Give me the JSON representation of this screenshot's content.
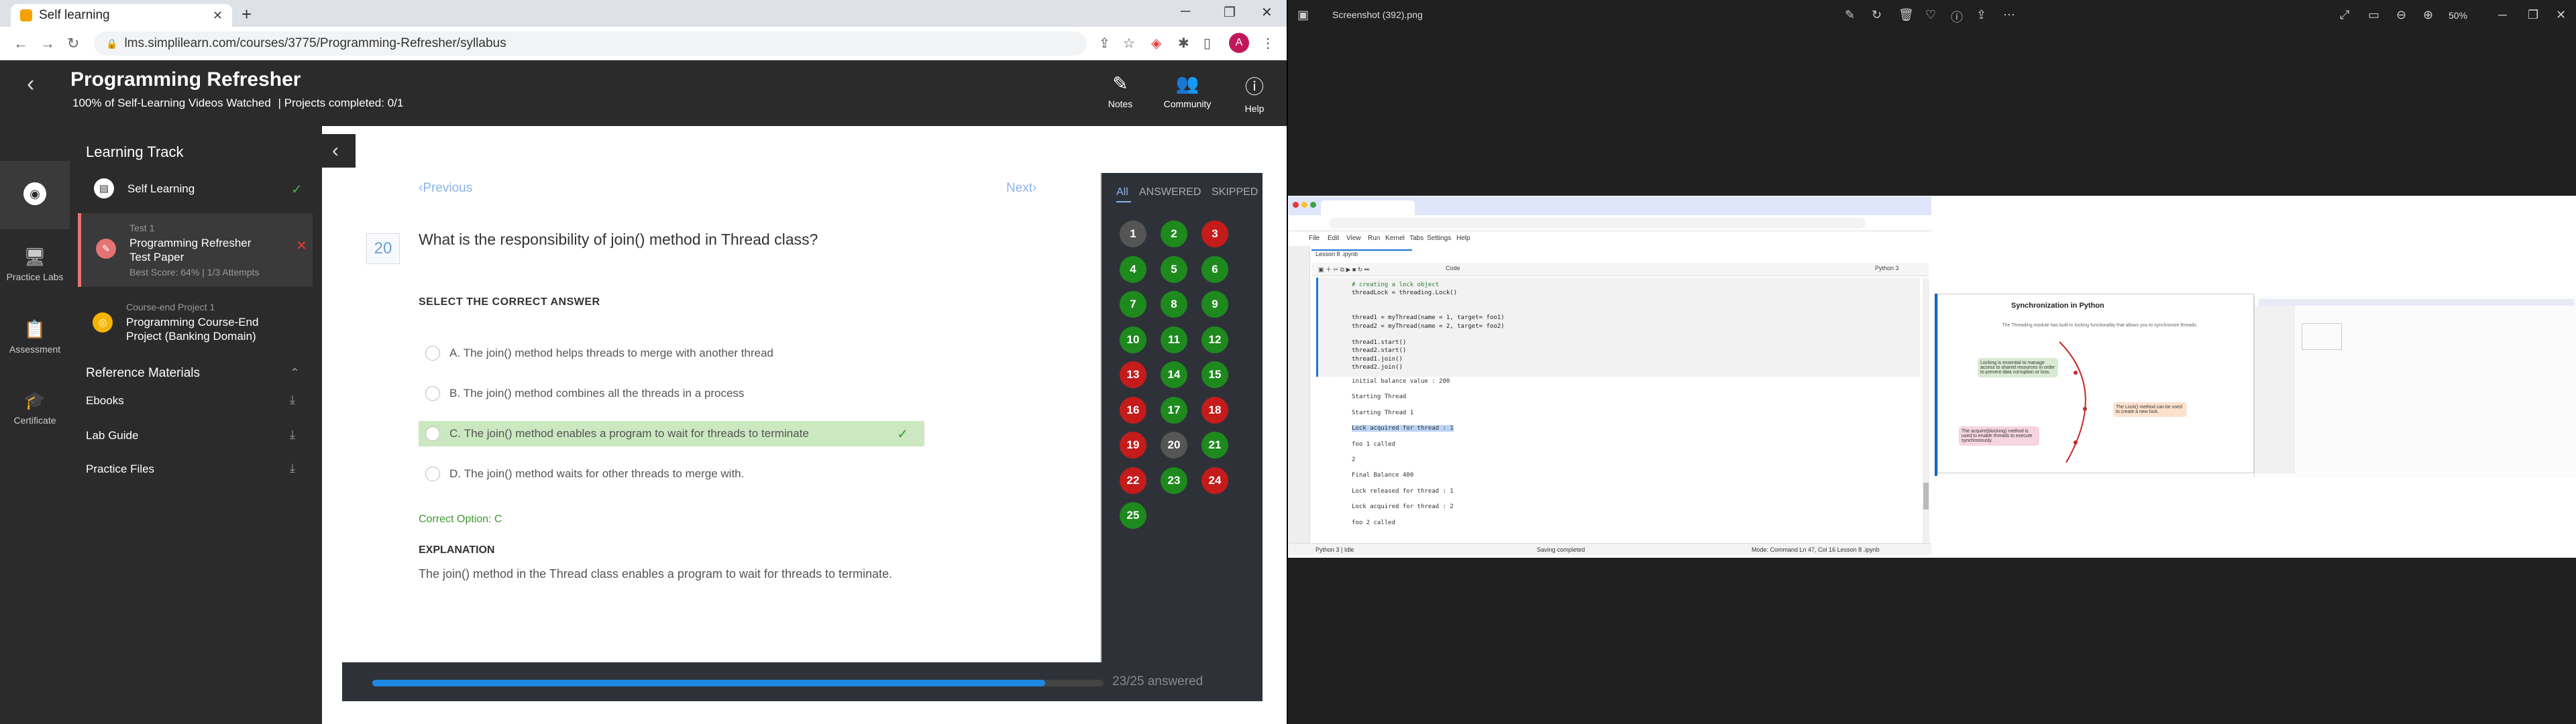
{
  "browser": {
    "tab_title": "Self learning",
    "url": "lms.simplilearn.com/courses/3775/Programming-Refresher/syllabus",
    "avatar_letter": "A"
  },
  "header": {
    "title": "Programming Refresher",
    "subtitle": "100% of Self-Learning Videos Watched",
    "projects": "| Projects completed: 0/1",
    "actions": [
      "Notes",
      "Community",
      "Help"
    ]
  },
  "rail": {
    "items": [
      "Practice Labs",
      "Assessment",
      "Certificate"
    ]
  },
  "sidebar": {
    "title": "Learning Track",
    "self_learning": "Self Learning",
    "test": {
      "kicker": "Test 1",
      "name": "Programming Refresher Test Paper",
      "meta": "Best Score: 64% | 1/3 Attempts"
    },
    "project": {
      "kicker": "Course-end Project 1",
      "name": "Programming Course-End Project (Banking Domain)"
    },
    "reference_title": "Reference Materials",
    "reference_items": [
      "Ebooks",
      "Lab Guide",
      "Practice Files"
    ]
  },
  "question": {
    "prev": "Previous",
    "next": "Next",
    "number": "20",
    "text": "What is the responsibility of join() method in Thread class?",
    "select_label": "SELECT THE CORRECT ANSWER",
    "options": [
      {
        "letter": "A.",
        "text": "The join() method helps threads to merge with another thread"
      },
      {
        "letter": "B.",
        "text": "The join() method combines all the threads in a process"
      },
      {
        "letter": "C.",
        "text": "The join() method enables a program to wait for threads to terminate"
      },
      {
        "letter": "D.",
        "text": "The join() method waits for other threads to merge with."
      }
    ],
    "correct_label": "Correct Option: C",
    "explanation_title": "EXPLANATION",
    "explanation": "The join() method in the Thread class enables a program to wait for threads to terminate."
  },
  "palette": {
    "tabs": [
      "All",
      "ANSWERED",
      "SKIPPED"
    ],
    "statuses": [
      "n",
      "g",
      "r",
      "g",
      "g",
      "g",
      "g",
      "g",
      "g",
      "g",
      "g",
      "g",
      "r",
      "g",
      "g",
      "r",
      "g",
      "r",
      "r",
      "n",
      "g",
      "r",
      "g",
      "r",
      "g"
    ]
  },
  "progress": {
    "fraction": 0.92,
    "text": "23/25 answered"
  },
  "viewer": {
    "filename": "Screenshot (392).png",
    "zoom": "50%"
  },
  "jupyter": {
    "tab": "Lesson 8 .ipynb",
    "menu": [
      "File",
      "Edit",
      "View",
      "Run",
      "Kernel",
      "Tabs",
      "Settings",
      "Help"
    ],
    "kernel": "Python 3",
    "celltype": "Code",
    "code": [
      "# creating a lock object",
      "threadLock = threading.Lock()",
      "",
      "",
      "thread1 = myThread(name = 1, target= foo1)",
      "thread2 = myThread(name = 2, target= foo2)",
      "",
      "thread1.start()",
      "thread2.start()",
      "thread1.join()",
      "thread2.join()"
    ],
    "output": [
      "initial balance value :  200",
      "",
      "Starting Thread",
      "",
      "Starting Thread  1",
      "",
      "Lock acquired for thread : 1",
      "",
      " foo 1 called",
      "",
      "2",
      "",
      "Final Balance 400",
      "",
      "Lock released for thread : 1",
      "",
      "Lock acquired for thread : 2",
      "",
      " foo 2 called"
    ],
    "status_left": "Python 3 | Idle",
    "status_mid": "Saving completed",
    "status_right": "Mode: Command   Ln 47, Col 16   Lesson 8 .ipynb"
  },
  "slide": {
    "title": "Synchronization in Python",
    "subtitle": "The Threading module has built-in locking functionality that allows you to synchronize threads.",
    "boxes": [
      "Locking is essential to manage access to shared resources in order to prevent data corruption or loss.",
      "The Lock() method can be used to create a new lock.",
      "The acquire(blocking) method is used to enable threads to execute synchronously."
    ]
  }
}
